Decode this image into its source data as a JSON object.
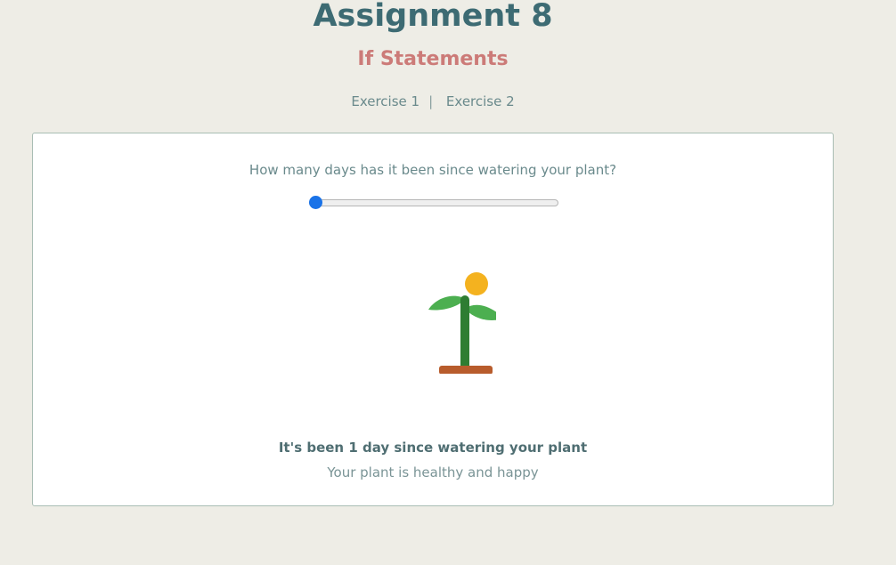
{
  "header": {
    "title": "Assignment 8",
    "subtitle": "If Statements"
  },
  "nav": {
    "items": [
      {
        "label": "Exercise 1"
      },
      {
        "label": "Exercise 2"
      }
    ],
    "separator": "|"
  },
  "exercise": {
    "question": "How many days has it been since watering your plant?",
    "slider": {
      "value": 1,
      "fraction": 0
    },
    "illustration": {
      "icons": [
        "plant-icon",
        "sun-icon"
      ],
      "colors": {
        "stem": "#2e7d32",
        "leaves": "#4caf50",
        "pot": "#b85c2c",
        "sun": "#f4b21f"
      }
    },
    "status": "It's been 1 day since watering your plant",
    "status_detail": "Your plant is healthy and happy"
  },
  "colors": {
    "background": "#eeede6",
    "title": "#3d6b73",
    "subtitle": "#cc7b78",
    "slider_accent": "#1a73e8"
  }
}
